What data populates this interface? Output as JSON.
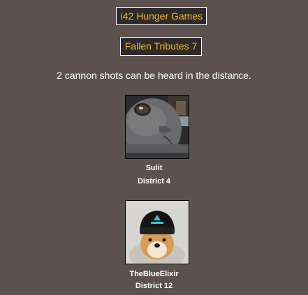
{
  "header": {
    "title": "í42 Hunger Games",
    "round": "Fallen Tributes 7"
  },
  "cannon_message": "2 cannon shots can be heard in the distance.",
  "tributes": [
    {
      "name": "Sulit",
      "district": "District 4",
      "avatar": "gray-cat-closeup"
    },
    {
      "name": "TheBlueElixir",
      "district": "District 12",
      "avatar": "shiba-dog-in-beanie"
    }
  ],
  "colors": {
    "background": "#5d5150",
    "box_fill": "#2e2a2a",
    "title_text": "#f1b721"
  }
}
